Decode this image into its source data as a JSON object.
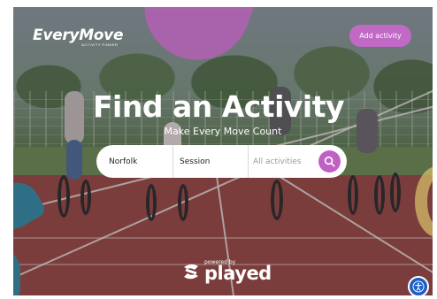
{
  "header": {
    "logo_text": "EveryMove",
    "logo_tagline": "ACTIVITY FINDER",
    "add_activity_label": "Add activity"
  },
  "hero": {
    "title": "Find an Activity",
    "subtitle": "Make Every Move Count"
  },
  "search": {
    "location_value": "Norfolk",
    "session_value": "Session",
    "activities_placeholder": "All activities",
    "search_icon": "search-icon"
  },
  "footer": {
    "powered_by": "powered by",
    "brand": "played",
    "brand_icon": "played-s-logo-icon"
  },
  "accessibility": {
    "icon": "accessibility-icon"
  },
  "colors": {
    "accent_purple": "#c060c4",
    "accessibility_blue": "#1d5dc4",
    "teal_shape": "#2f6f86"
  }
}
